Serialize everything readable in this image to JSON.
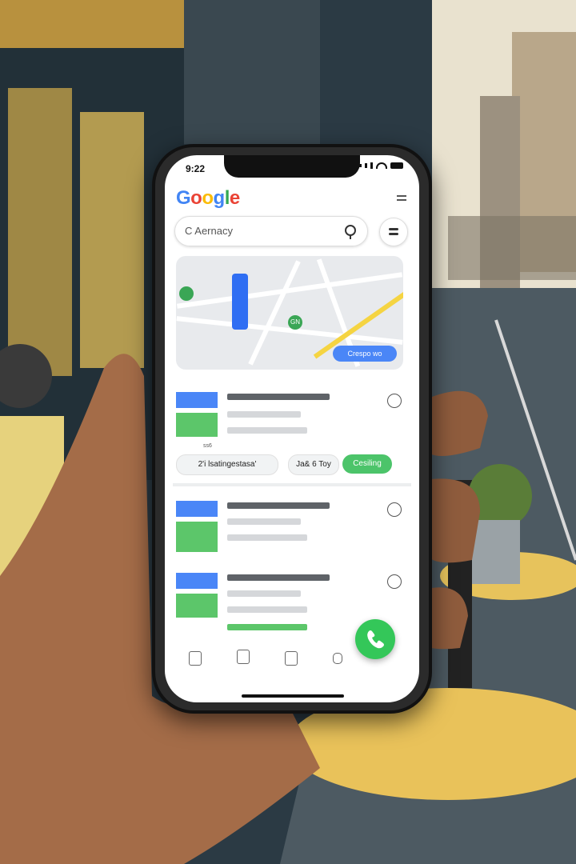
{
  "status": {
    "time": "9:22"
  },
  "header": {
    "logo_text": "Google",
    "logo_colors": [
      "#4285F4",
      "#EA4335",
      "#FBBC05",
      "#4285F4",
      "#34A853",
      "#EA4335"
    ]
  },
  "search": {
    "value": "C Aernacy"
  },
  "map": {
    "chip_label": "Crespo wo",
    "pin_label": "GN"
  },
  "results": [
    {
      "chips": [
        "2'i lsatingestasa'",
        "Ja& 6 Toy",
        "Cesiling"
      ],
      "sub_label": "ss6"
    },
    {
      "chips": []
    },
    {
      "chips": []
    }
  ],
  "colors": {
    "accent_blue": "#4a86f7",
    "accent_green": "#34c759"
  },
  "icons": [
    "menu-icon",
    "search-icon",
    "filter-icon",
    "more-icon",
    "phone-icon",
    "home-icon",
    "bookmark-icon",
    "lock-icon",
    "person-icon"
  ]
}
